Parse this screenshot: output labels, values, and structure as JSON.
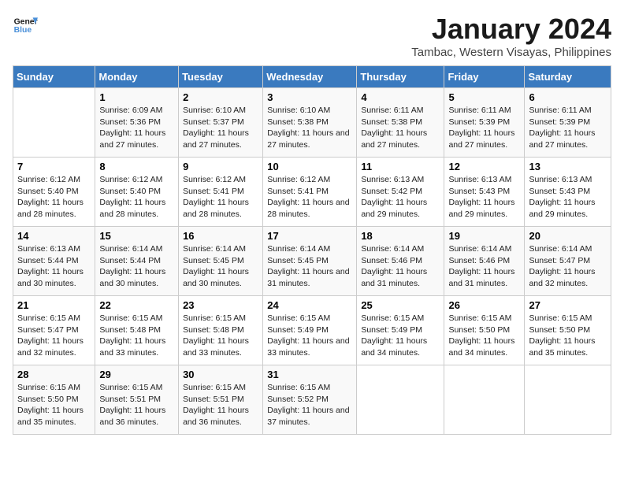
{
  "logo": {
    "line1": "General",
    "line2": "Blue"
  },
  "title": "January 2024",
  "subtitle": "Tambac, Western Visayas, Philippines",
  "headers": [
    "Sunday",
    "Monday",
    "Tuesday",
    "Wednesday",
    "Thursday",
    "Friday",
    "Saturday"
  ],
  "weeks": [
    [
      {
        "day": "",
        "sunrise": "",
        "sunset": "",
        "daylight": ""
      },
      {
        "day": "1",
        "sunrise": "Sunrise: 6:09 AM",
        "sunset": "Sunset: 5:36 PM",
        "daylight": "Daylight: 11 hours and 27 minutes."
      },
      {
        "day": "2",
        "sunrise": "Sunrise: 6:10 AM",
        "sunset": "Sunset: 5:37 PM",
        "daylight": "Daylight: 11 hours and 27 minutes."
      },
      {
        "day": "3",
        "sunrise": "Sunrise: 6:10 AM",
        "sunset": "Sunset: 5:38 PM",
        "daylight": "Daylight: 11 hours and 27 minutes."
      },
      {
        "day": "4",
        "sunrise": "Sunrise: 6:11 AM",
        "sunset": "Sunset: 5:38 PM",
        "daylight": "Daylight: 11 hours and 27 minutes."
      },
      {
        "day": "5",
        "sunrise": "Sunrise: 6:11 AM",
        "sunset": "Sunset: 5:39 PM",
        "daylight": "Daylight: 11 hours and 27 minutes."
      },
      {
        "day": "6",
        "sunrise": "Sunrise: 6:11 AM",
        "sunset": "Sunset: 5:39 PM",
        "daylight": "Daylight: 11 hours and 27 minutes."
      }
    ],
    [
      {
        "day": "7",
        "sunrise": "Sunrise: 6:12 AM",
        "sunset": "Sunset: 5:40 PM",
        "daylight": "Daylight: 11 hours and 28 minutes."
      },
      {
        "day": "8",
        "sunrise": "Sunrise: 6:12 AM",
        "sunset": "Sunset: 5:40 PM",
        "daylight": "Daylight: 11 hours and 28 minutes."
      },
      {
        "day": "9",
        "sunrise": "Sunrise: 6:12 AM",
        "sunset": "Sunset: 5:41 PM",
        "daylight": "Daylight: 11 hours and 28 minutes."
      },
      {
        "day": "10",
        "sunrise": "Sunrise: 6:12 AM",
        "sunset": "Sunset: 5:41 PM",
        "daylight": "Daylight: 11 hours and 28 minutes."
      },
      {
        "day": "11",
        "sunrise": "Sunrise: 6:13 AM",
        "sunset": "Sunset: 5:42 PM",
        "daylight": "Daylight: 11 hours and 29 minutes."
      },
      {
        "day": "12",
        "sunrise": "Sunrise: 6:13 AM",
        "sunset": "Sunset: 5:43 PM",
        "daylight": "Daylight: 11 hours and 29 minutes."
      },
      {
        "day": "13",
        "sunrise": "Sunrise: 6:13 AM",
        "sunset": "Sunset: 5:43 PM",
        "daylight": "Daylight: 11 hours and 29 minutes."
      }
    ],
    [
      {
        "day": "14",
        "sunrise": "Sunrise: 6:13 AM",
        "sunset": "Sunset: 5:44 PM",
        "daylight": "Daylight: 11 hours and 30 minutes."
      },
      {
        "day": "15",
        "sunrise": "Sunrise: 6:14 AM",
        "sunset": "Sunset: 5:44 PM",
        "daylight": "Daylight: 11 hours and 30 minutes."
      },
      {
        "day": "16",
        "sunrise": "Sunrise: 6:14 AM",
        "sunset": "Sunset: 5:45 PM",
        "daylight": "Daylight: 11 hours and 30 minutes."
      },
      {
        "day": "17",
        "sunrise": "Sunrise: 6:14 AM",
        "sunset": "Sunset: 5:45 PM",
        "daylight": "Daylight: 11 hours and 31 minutes."
      },
      {
        "day": "18",
        "sunrise": "Sunrise: 6:14 AM",
        "sunset": "Sunset: 5:46 PM",
        "daylight": "Daylight: 11 hours and 31 minutes."
      },
      {
        "day": "19",
        "sunrise": "Sunrise: 6:14 AM",
        "sunset": "Sunset: 5:46 PM",
        "daylight": "Daylight: 11 hours and 31 minutes."
      },
      {
        "day": "20",
        "sunrise": "Sunrise: 6:14 AM",
        "sunset": "Sunset: 5:47 PM",
        "daylight": "Daylight: 11 hours and 32 minutes."
      }
    ],
    [
      {
        "day": "21",
        "sunrise": "Sunrise: 6:15 AM",
        "sunset": "Sunset: 5:47 PM",
        "daylight": "Daylight: 11 hours and 32 minutes."
      },
      {
        "day": "22",
        "sunrise": "Sunrise: 6:15 AM",
        "sunset": "Sunset: 5:48 PM",
        "daylight": "Daylight: 11 hours and 33 minutes."
      },
      {
        "day": "23",
        "sunrise": "Sunrise: 6:15 AM",
        "sunset": "Sunset: 5:48 PM",
        "daylight": "Daylight: 11 hours and 33 minutes."
      },
      {
        "day": "24",
        "sunrise": "Sunrise: 6:15 AM",
        "sunset": "Sunset: 5:49 PM",
        "daylight": "Daylight: 11 hours and 33 minutes."
      },
      {
        "day": "25",
        "sunrise": "Sunrise: 6:15 AM",
        "sunset": "Sunset: 5:49 PM",
        "daylight": "Daylight: 11 hours and 34 minutes."
      },
      {
        "day": "26",
        "sunrise": "Sunrise: 6:15 AM",
        "sunset": "Sunset: 5:50 PM",
        "daylight": "Daylight: 11 hours and 34 minutes."
      },
      {
        "day": "27",
        "sunrise": "Sunrise: 6:15 AM",
        "sunset": "Sunset: 5:50 PM",
        "daylight": "Daylight: 11 hours and 35 minutes."
      }
    ],
    [
      {
        "day": "28",
        "sunrise": "Sunrise: 6:15 AM",
        "sunset": "Sunset: 5:50 PM",
        "daylight": "Daylight: 11 hours and 35 minutes."
      },
      {
        "day": "29",
        "sunrise": "Sunrise: 6:15 AM",
        "sunset": "Sunset: 5:51 PM",
        "daylight": "Daylight: 11 hours and 36 minutes."
      },
      {
        "day": "30",
        "sunrise": "Sunrise: 6:15 AM",
        "sunset": "Sunset: 5:51 PM",
        "daylight": "Daylight: 11 hours and 36 minutes."
      },
      {
        "day": "31",
        "sunrise": "Sunrise: 6:15 AM",
        "sunset": "Sunset: 5:52 PM",
        "daylight": "Daylight: 11 hours and 37 minutes."
      },
      {
        "day": "",
        "sunrise": "",
        "sunset": "",
        "daylight": ""
      },
      {
        "day": "",
        "sunrise": "",
        "sunset": "",
        "daylight": ""
      },
      {
        "day": "",
        "sunrise": "",
        "sunset": "",
        "daylight": ""
      }
    ]
  ]
}
